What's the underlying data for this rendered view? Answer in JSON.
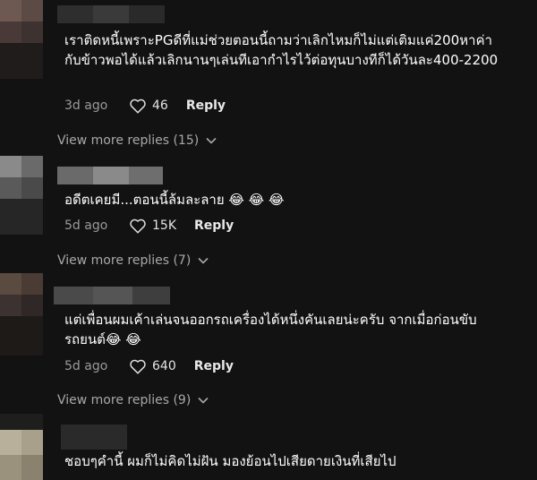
{
  "comments": [
    {
      "text": "เราติดหนี้เพราะPGดีที่แม่ช่วยตอนนี้ถามว่าเลิกไหมก็ไม่แต่เติมแค่200หาค่ากับข้าวพอได้แล้วเลิกนานๆเล่นทีเอากำไรไว้ต่อทุนบางทีก็ได้วันละ400-2200",
      "date": "3d ago",
      "likes": "46",
      "reply_label": "Reply",
      "view_more": "View more replies (15)"
    },
    {
      "text": "อดีตเคยมี...ตอนนี้ล้มละลาย 😂 😂 😂",
      "date": "5d ago",
      "likes": "15K",
      "reply_label": "Reply",
      "view_more": "View more replies (7)"
    },
    {
      "text": "แต่เพื่อนผมเค้าเล่นจนออกรถเครื่องได้หนึ่งคันเลยน่ะครับ จากเมื่อก่อนขับรถยนต์😂 😂",
      "date": "5d ago",
      "likes": "640",
      "reply_label": "Reply",
      "view_more": "View more replies (9)"
    },
    {
      "text": "ชอบๆคำนี้ ผมก็ไม่คิดไม่ฝัน มองย้อนไปเสียดายเงินที่เสียไป"
    }
  ],
  "colors": {
    "background": "#121212",
    "secondary_text": "#9a9a9a"
  },
  "icons": [
    "heart-icon",
    "chevron-down-icon"
  ]
}
